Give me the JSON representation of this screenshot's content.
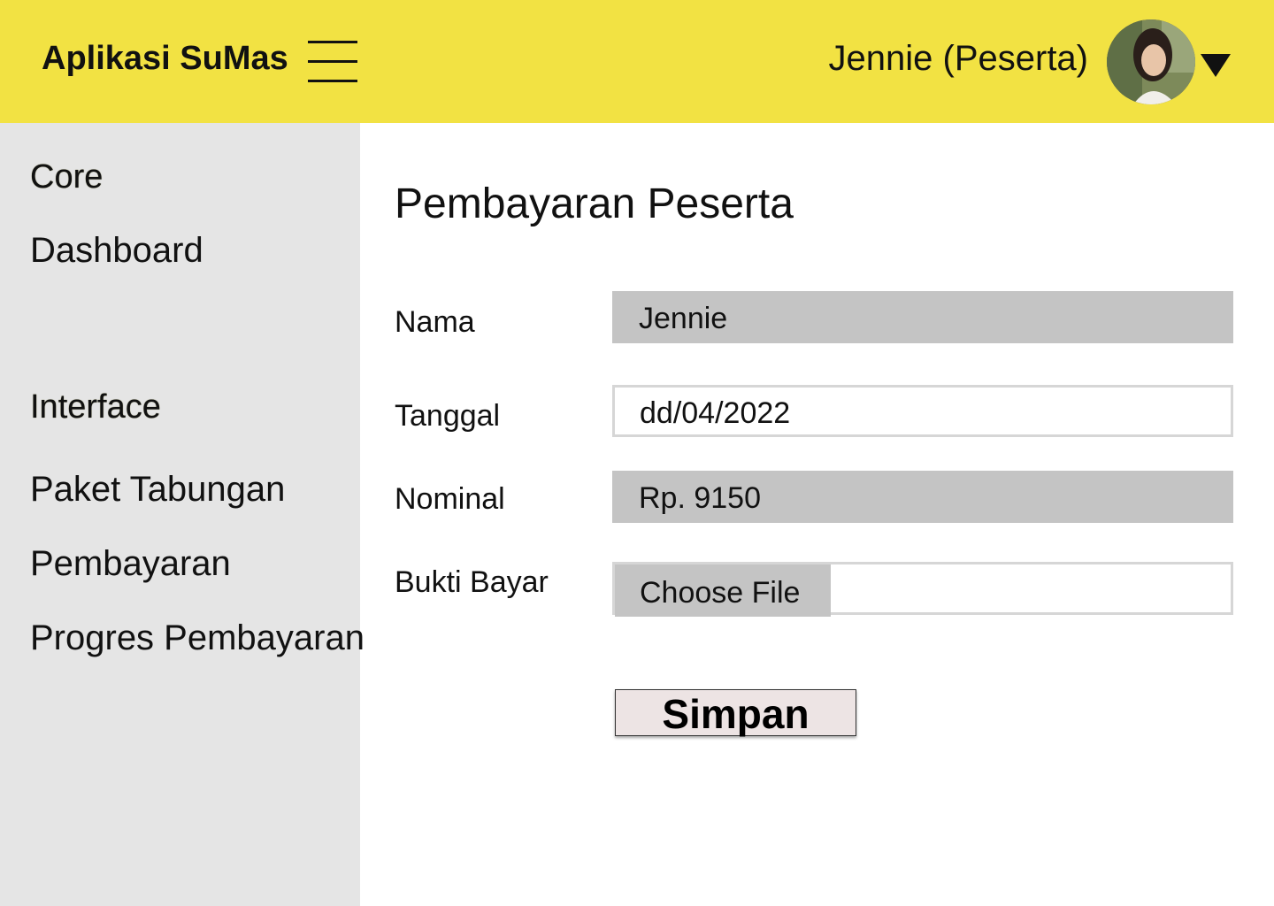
{
  "header": {
    "app_title": "Aplikasi SuMas",
    "menu_icon": "hamburger-menu-icon",
    "user_label": "Jennie (Peserta)",
    "dropdown_icon": "caret-down-icon",
    "background_color": "#f2e243"
  },
  "sidebar": {
    "sections": [
      {
        "heading": "Core",
        "items": [
          "Dashboard"
        ]
      },
      {
        "heading": "Interface",
        "items": [
          "Paket Tabungan",
          "Pembayaran",
          "Progres Pembayaran"
        ]
      }
    ],
    "background_color": "#e5e5e5"
  },
  "main": {
    "title": "Pembayaran Peserta",
    "form": {
      "nama": {
        "label": "Nama",
        "value": "Jennie"
      },
      "tanggal": {
        "label": "Tanggal",
        "value": "dd/04/2022"
      },
      "nominal": {
        "label": "Nominal",
        "value": "Rp. 9150"
      },
      "bukti_bayar": {
        "label": "Bukti Bayar",
        "button_label": "Choose File"
      }
    },
    "submit_label": "Simpan"
  }
}
